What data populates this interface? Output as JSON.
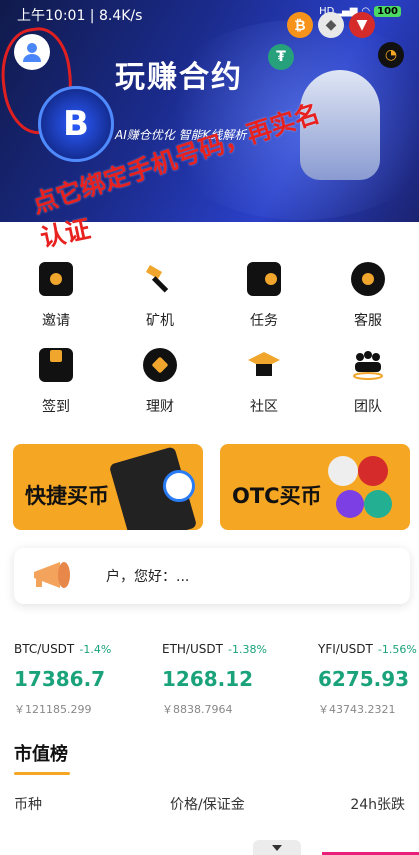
{
  "status_bar": {
    "time_speed": "上午10:01 | 8.4K/s",
    "battery": "100"
  },
  "banner": {
    "title": "玩赚合约",
    "subtitle": "AI赚仓优化 智能K线解析",
    "coin_letter": "B",
    "annotation_line1": "点它绑定手机号码，再实名",
    "annotation_line2": "认证"
  },
  "quick_actions": [
    {
      "label": "邀请",
      "icon": "invite-mail-icon"
    },
    {
      "label": "矿机",
      "icon": "mining-hammer-icon"
    },
    {
      "label": "任务",
      "icon": "task-radio-icon"
    },
    {
      "label": "客服",
      "icon": "customer-service-icon"
    },
    {
      "label": "签到",
      "icon": "gift-checkin-icon"
    },
    {
      "label": "理财",
      "icon": "finance-coin-icon"
    },
    {
      "label": "社区",
      "icon": "graduation-cap-icon"
    },
    {
      "label": "团队",
      "icon": "team-people-icon"
    }
  ],
  "promos": {
    "quick_buy": "快捷买币",
    "otc_buy": "OTC买币"
  },
  "notice": {
    "text": " 户，您好：..."
  },
  "tickers": [
    {
      "pair": "BTC/USDT",
      "change": "-1.4%",
      "price": "17386.7",
      "cny": "￥121185.299"
    },
    {
      "pair": "ETH/USDT",
      "change": "-1.38%",
      "price": "1268.12",
      "cny": "￥8838.7964"
    },
    {
      "pair": "YFI/USDT",
      "change": "-1.56%",
      "price": "6275.93",
      "cny": "￥43743.2321"
    }
  ],
  "ranking": {
    "title": "市值榜",
    "col_coin": "币种",
    "col_price": "价格/保证金",
    "col_change": "24h张跌"
  },
  "colors": {
    "accent": "#f5a623",
    "up_green": "#1aa37a",
    "annotation_red": "#e8201e"
  }
}
